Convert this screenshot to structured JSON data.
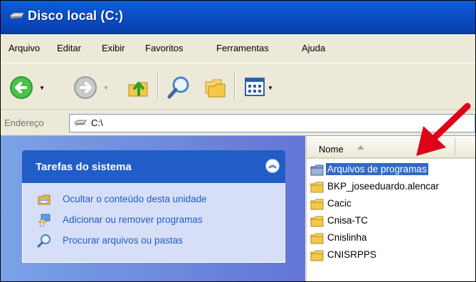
{
  "window": {
    "title": "Disco local (C:)"
  },
  "menu": {
    "items": [
      "Arquivo",
      "Editar",
      "Exibir",
      "Favoritos",
      "Ferramentas",
      "Ajuda"
    ]
  },
  "toolbar": {
    "buttons": [
      {
        "name": "back-button",
        "icon": "back-arrow-icon"
      },
      {
        "name": "forward-button",
        "icon": "forward-arrow-icon"
      },
      {
        "name": "up-button",
        "icon": "up-folder-icon"
      },
      {
        "name": "search-button",
        "icon": "magnifier-icon"
      },
      {
        "name": "folders-button",
        "icon": "folders-icon"
      },
      {
        "name": "views-button",
        "icon": "views-icon"
      }
    ]
  },
  "address": {
    "label": "Endereço",
    "value": "C:\\",
    "icon": "drive-icon"
  },
  "tasks": {
    "title": "Tarefas do sistema",
    "items": [
      {
        "label": "Ocultar o conteúdo desta unidade",
        "icon": "hide-drive-icon"
      },
      {
        "label": "Adicionar ou remover programas",
        "icon": "add-remove-programs-icon"
      },
      {
        "label": "Procurar arquivos ou pastas",
        "icon": "search-icon"
      }
    ]
  },
  "files": {
    "column_name": "Nome",
    "sort": "ascending",
    "items": [
      {
        "name": "Arquivos de programas",
        "selected": true,
        "icon": "folder-icon"
      },
      {
        "name": "BKP_joseeduardo.alencar",
        "selected": false,
        "icon": "folder-icon"
      },
      {
        "name": "Cacic",
        "selected": false,
        "icon": "folder-icon"
      },
      {
        "name": "Cnisa-TC",
        "selected": false,
        "icon": "folder-icon"
      },
      {
        "name": "Cnislinha",
        "selected": false,
        "icon": "folder-icon"
      },
      {
        "name": "CNISRPPS",
        "selected": false,
        "icon": "folder-icon"
      }
    ]
  },
  "colors": {
    "titlebar": "#0a4fc7",
    "selection": "#316ac5",
    "task_link": "#215dc6",
    "annotation_arrow": "#e0001a"
  }
}
